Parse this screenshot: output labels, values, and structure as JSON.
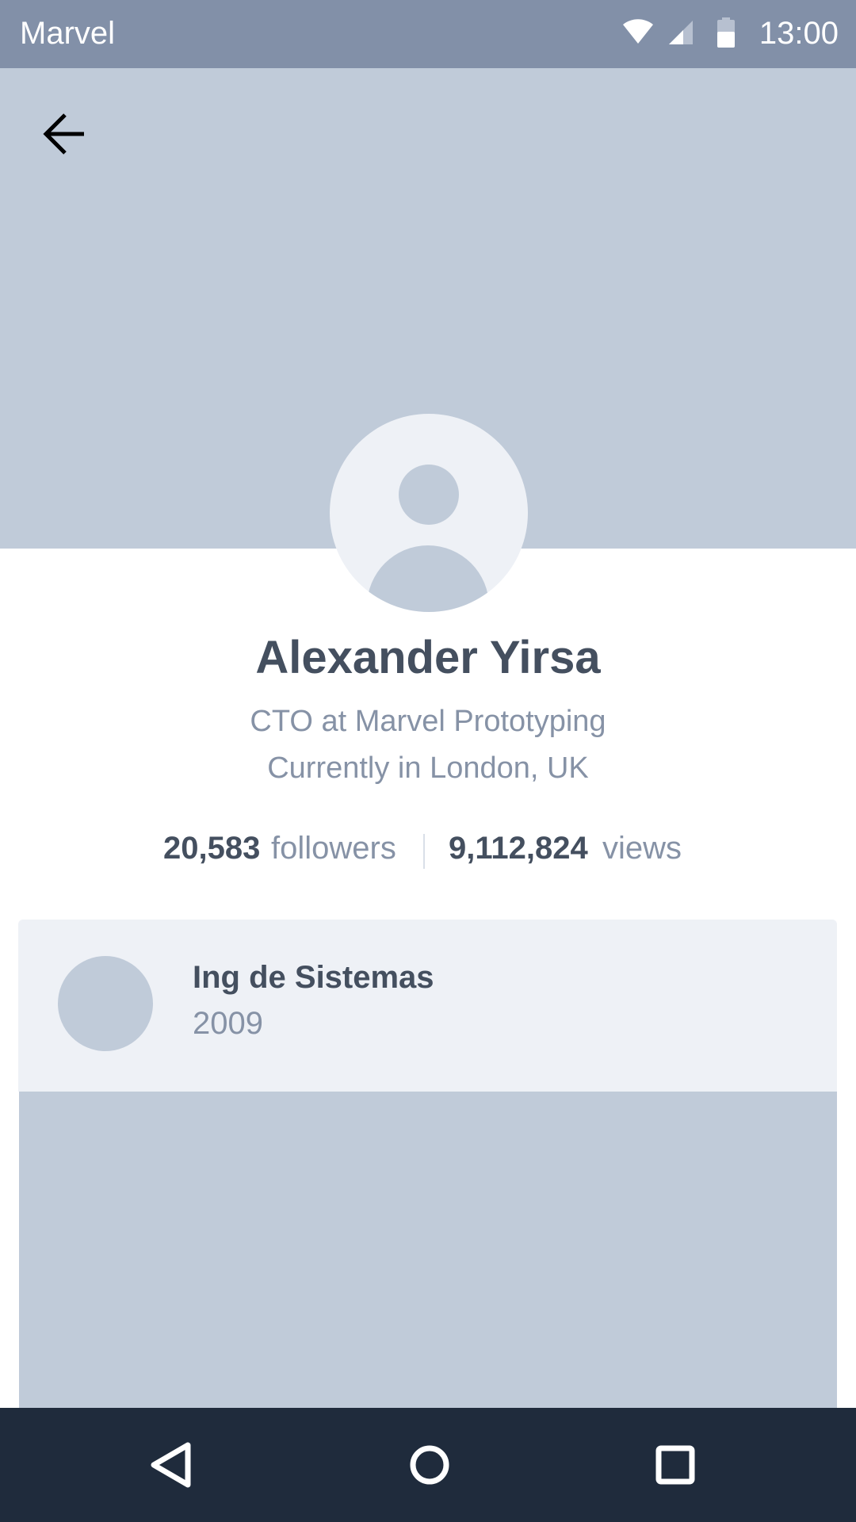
{
  "status_bar": {
    "carrier": "Marvel",
    "time": "13:00",
    "icons": [
      "wifi-icon",
      "signal-icon",
      "battery-icon"
    ]
  },
  "header": {
    "back_icon": "arrow-left-icon"
  },
  "profile": {
    "name": "Alexander Yirsa",
    "role": "CTO at Marvel Prototyping",
    "location": "Currently in London, UK",
    "followers_count": "20,583",
    "followers_label": "followers",
    "views_count": "9,112,824",
    "views_label": "views"
  },
  "card": {
    "title": "Ing de Sistemas",
    "year": "2009"
  },
  "nav": {
    "icons": [
      "nav-back-icon",
      "nav-home-icon",
      "nav-recent-apps-icon"
    ]
  },
  "colors": {
    "status_bar": "#8290a8",
    "cover": "#c0cbd9",
    "text_dark": "#444f5f",
    "text_muted": "#8692a6",
    "card_bg": "#eef1f6",
    "nav_bar": "#1f2b3c"
  }
}
